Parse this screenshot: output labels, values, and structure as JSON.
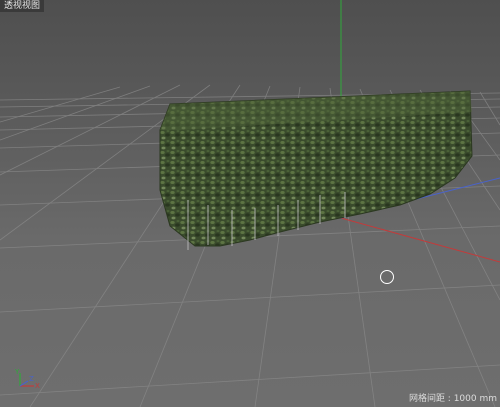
{
  "viewport": {
    "title": "透视视图",
    "grid_status": "网格间距 : 1000 mm",
    "axis_labels": {
      "y": "Y",
      "z": "Z",
      "x": "X"
    }
  },
  "icons": {
    "cursor": "circle-cursor-icon",
    "axes": "axis-gizmo-icon"
  },
  "colors": {
    "y_axis": "#2faa3a",
    "x_axis": "#c23b3b",
    "z_axis": "#4a63c8",
    "foliage_dark": "#2f3f24",
    "foliage_mid": "#4c6336",
    "foliage_light": "#6f8455"
  }
}
